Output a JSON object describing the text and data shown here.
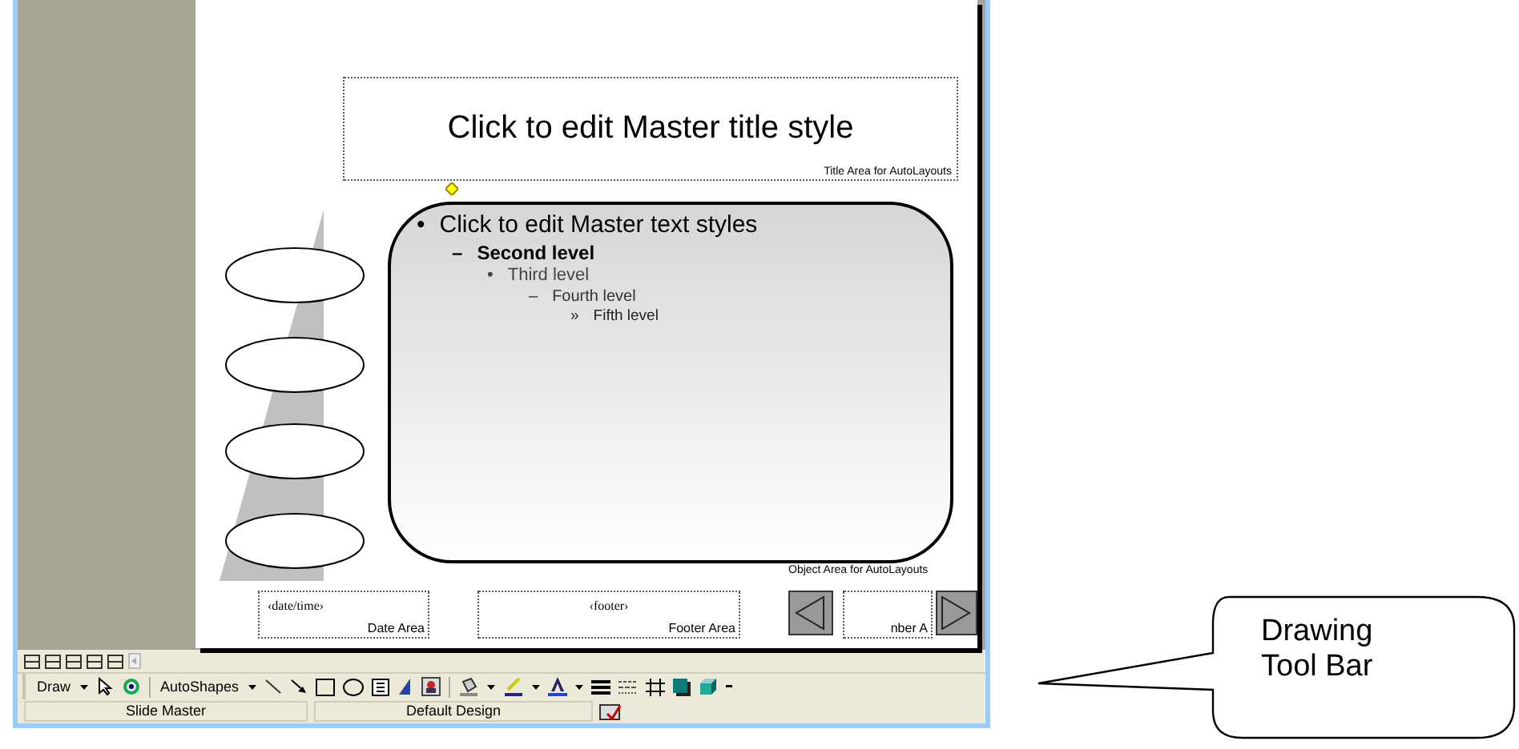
{
  "slide": {
    "title": "Click to edit Master title style",
    "title_area_label": "Title Area for AutoLayouts",
    "body": [
      {
        "bullet": "•",
        "text": "Click to edit Master text styles",
        "children": [
          {
            "bullet": "–",
            "text": "Second level",
            "children": [
              {
                "bullet": "•",
                "text": "Third level",
                "children": [
                  {
                    "bullet": "–",
                    "text": "Fourth level",
                    "children": [
                      {
                        "bullet": "»",
                        "text": "Fifth level"
                      }
                    ]
                  }
                ]
              }
            ]
          }
        ]
      }
    ],
    "object_area_label": "Object Area for AutoLayouts",
    "footer_boxes": [
      {
        "placeholder": "‹date/time›",
        "label": "Date Area"
      },
      {
        "placeholder": "‹footer›",
        "label": "Footer Area"
      },
      {
        "label": "nber A"
      }
    ]
  },
  "draw_toolbar": {
    "menus": [
      "Draw",
      "AutoShapes"
    ]
  },
  "status_bar": [
    "Slide Master",
    "Default Design"
  ],
  "callout": {
    "text": "Drawing Tool Bar"
  }
}
